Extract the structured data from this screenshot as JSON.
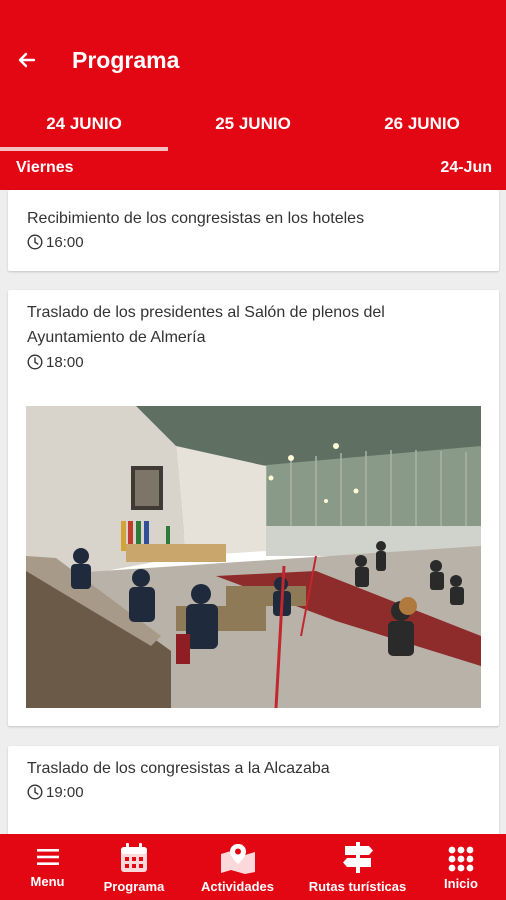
{
  "header": {
    "title": "Programa",
    "back_icon": "arrow-left-icon"
  },
  "tabs": [
    {
      "label": "24 JUNIO",
      "selected": true
    },
    {
      "label": "25 JUNIO",
      "selected": false
    },
    {
      "label": "26 JUNIO",
      "selected": false
    }
  ],
  "day": {
    "name": "Viernes",
    "date": "24-Jun"
  },
  "events": [
    {
      "title": "Recibimiento de los congresistas en los hoteles",
      "time": "16:00"
    },
    {
      "title": "Traslado de los presidentes al Salón de plenos del Ayuntamiento de Almería",
      "time": "18:00",
      "image": "council-chamber-photo"
    },
    {
      "title": "Traslado de los congresistas a la Alcazaba",
      "time": "19:00"
    }
  ],
  "bottom_nav": [
    {
      "label": "Menu",
      "icon": "hamburger-menu-icon"
    },
    {
      "label": "Programa",
      "icon": "calendar-icon"
    },
    {
      "label": "Actividades",
      "icon": "map-pin-icon"
    },
    {
      "label": "Rutas turísticas",
      "icon": "signpost-icon"
    },
    {
      "label": "Inicio",
      "icon": "grid-icon"
    }
  ],
  "colors": {
    "brand_red": "#e30613",
    "background": "#eeeeee",
    "card": "#ffffff"
  }
}
